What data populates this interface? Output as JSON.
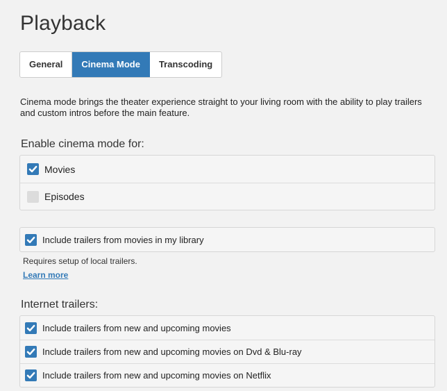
{
  "page": {
    "title": "Playback"
  },
  "tabs": [
    {
      "label": "General",
      "active": false
    },
    {
      "label": "Cinema Mode",
      "active": true
    },
    {
      "label": "Transcoding",
      "active": false
    }
  ],
  "intro_text": "Cinema mode brings the theater experience straight to your living room with the ability to play trailers and custom intros before the main feature.",
  "enable_section": {
    "heading": "Enable cinema mode for:",
    "options": [
      {
        "label": "Movies",
        "checked": true
      },
      {
        "label": "Episodes",
        "checked": false
      }
    ]
  },
  "local_trailers": {
    "label": "Include trailers from movies in my library",
    "checked": true,
    "note": "Requires setup of local trailers.",
    "learn_more": "Learn more"
  },
  "internet_trailers": {
    "heading": "Internet trailers:",
    "options": [
      {
        "label": "Include trailers from new and upcoming movies",
        "checked": true
      },
      {
        "label": "Include trailers from new and upcoming movies on Dvd & Blu-ray",
        "checked": true
      },
      {
        "label": "Include trailers from new and upcoming movies on Netflix",
        "checked": true
      }
    ]
  },
  "colors": {
    "accent": "#337ab7",
    "background": "#f2f2f2",
    "unchecked": "#dcdcdc"
  }
}
